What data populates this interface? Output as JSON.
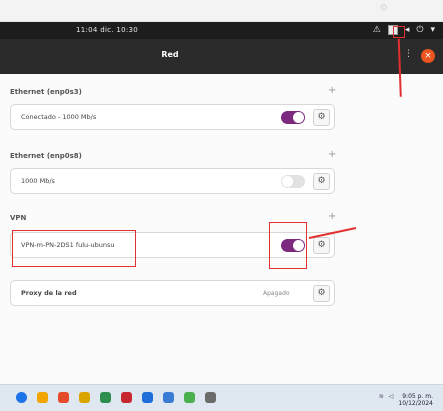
{
  "panel": {
    "clock": "11:04 dic. 10:30"
  },
  "header": {
    "title": "Red"
  },
  "sections": {
    "ethernet1": {
      "title": "Ethernet (enp0s3)",
      "item": "Conectado - 1000 Mb/s",
      "toggle_on": true
    },
    "ethernet2": {
      "title": "Ethernet (enp0s8)",
      "item": "1000 Mb/s",
      "toggle_on": false
    },
    "vpn": {
      "title": "VPN",
      "item": "VPN-m-PN-2DS1 fulu-ubunsu",
      "toggle_on": true
    },
    "proxy": {
      "title": "Proxy de la red",
      "status": "Apagado"
    }
  },
  "taskbar": {
    "time": "9:05 p. m.",
    "date": "10/12/2024"
  },
  "colors": {
    "accent_purple": "#7b2a80",
    "ubuntu_orange": "#e95420",
    "annotation_red": "#e03030"
  }
}
